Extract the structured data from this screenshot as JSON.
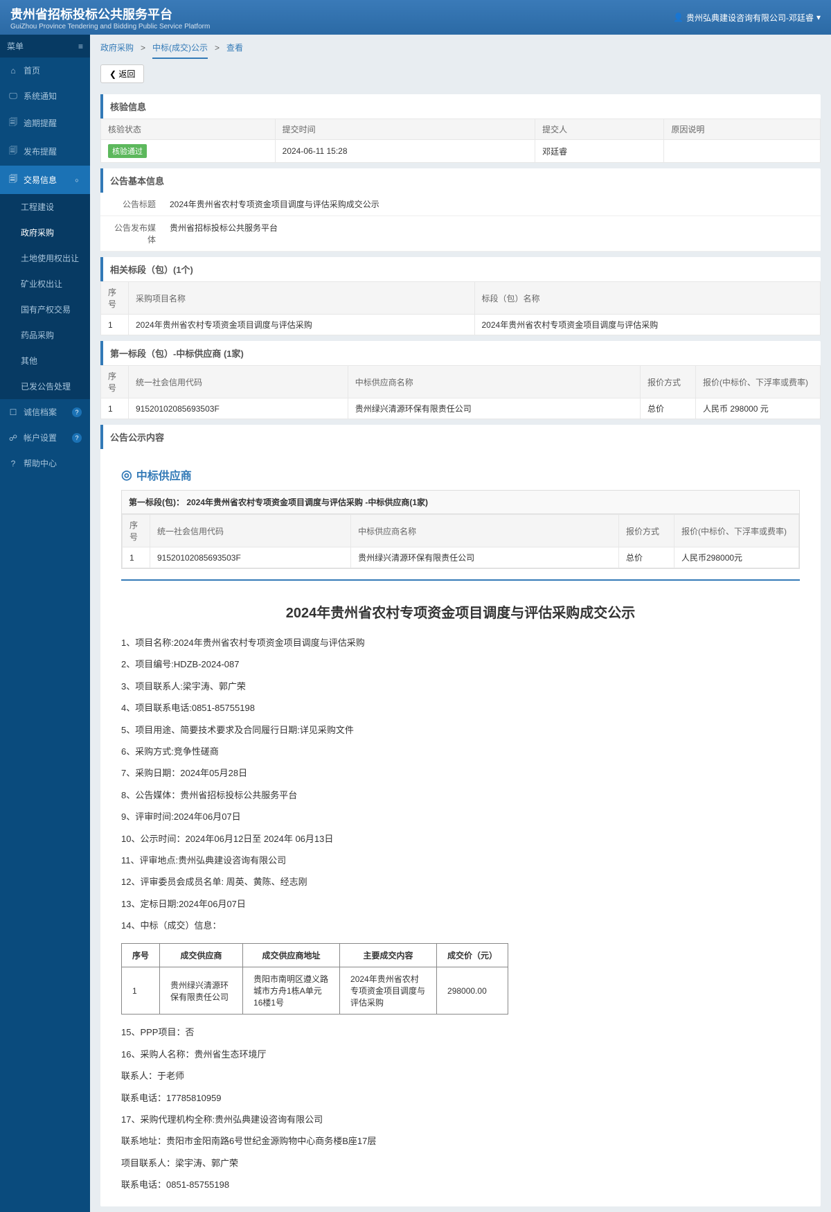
{
  "header": {
    "title": "贵州省招标投标公共服务平台",
    "subtitle": "GuiZhou Province Tendering and Bidding Public Service Platform",
    "user": "贵州弘典建设咨询有限公司-邓廷睿"
  },
  "sidebar": {
    "menu_label": "菜单",
    "items": [
      {
        "icon": "⌂",
        "label": "首页"
      },
      {
        "icon": "🖵",
        "label": "系统通知"
      },
      {
        "icon": "🗐",
        "label": "逾期提醒"
      },
      {
        "icon": "🗐",
        "label": "发布提醒"
      },
      {
        "icon": "🗐",
        "label": "交易信息",
        "badge": "○",
        "active": true
      },
      {
        "icon": "☐",
        "label": "诚信档案",
        "badge": "?"
      },
      {
        "icon": "☍",
        "label": "帐户设置",
        "badge": "?"
      },
      {
        "icon": "?",
        "label": "帮助中心"
      }
    ],
    "submenu": [
      "工程建设",
      "政府采购",
      "土地使用权出让",
      "矿业权出让",
      "国有产权交易",
      "药品采购",
      "其他",
      "已发公告处理"
    ]
  },
  "breadcrumb": [
    "政府采购",
    "中标(成交)公示",
    "查看"
  ],
  "return_btn": "❮ 返回",
  "verify": {
    "title": "核验信息",
    "headers": [
      "核验状态",
      "提交时间",
      "提交人",
      "原因说明"
    ],
    "row": {
      "status": "核验通过",
      "time": "2024-06-11 15:28",
      "person": "邓廷睿",
      "reason": ""
    }
  },
  "basic": {
    "title": "公告基本信息",
    "rows": [
      {
        "label": "公告标题",
        "value": "2024年贵州省农村专项资金项目调度与评估采购成交公示"
      },
      {
        "label": "公告发布媒体",
        "value": "贵州省招标投标公共服务平台"
      }
    ]
  },
  "sections": {
    "title": "相关标段（包）(1个)",
    "headers": [
      "序号",
      "采购项目名称",
      "标段（包）名称"
    ],
    "rows": [
      [
        "1",
        "2024年贵州省农村专项资金项目调度与评估采购",
        "2024年贵州省农村专项资金项目调度与评估采购"
      ]
    ]
  },
  "supplier": {
    "title": "第一标段（包）-中标供应商 (1家)",
    "headers": [
      "序号",
      "统一社会信用代码",
      "中标供应商名称",
      "报价方式",
      "报价(中标价、下浮率或费率)"
    ],
    "rows": [
      [
        "1",
        "91520102085693503F",
        "贵州绿兴清源环保有限责任公司",
        "总价",
        "人民币 298000 元"
      ]
    ]
  },
  "content": {
    "title": "公告公示内容",
    "supplier_label": "中标供应商",
    "sup_title": "第一标段(包)：  2024年贵州省农村专项资金项目调度与评估采购 -中标供应商(1家)",
    "sup_headers": [
      "序号",
      "统一社会信用代码",
      "中标供应商名称",
      "报价方式",
      "报价(中标价、下浮率或费率)"
    ],
    "sup_rows": [
      [
        "1",
        "91520102085693503F",
        "贵州绿兴清源环保有限责任公司",
        "总价",
        "人民币298000元"
      ]
    ],
    "doc_title": "2024年贵州省农村专项资金项目调度与评估采购成交公示",
    "paragraphs": [
      "1、项目名称:2024年贵州省农村专项资金项目调度与评估采购",
      "2、项目编号:HDZB-2024-087",
      "3、项目联系人:梁宇涛、郭广荣",
      "4、项目联系电话:0851-85755198",
      "5、项目用途、简要技术要求及合同履行日期:详见采购文件",
      "6、采购方式:竞争性磋商",
      "7、采购日期：2024年05月28日",
      "8、公告媒体：贵州省招标投标公共服务平台",
      "9、评审时间:2024年06月07日",
      "10、公示时间：2024年06月12日至  2024年  06月13日",
      "11、评审地点:贵州弘典建设咨询有限公司",
      "12、评审委员会成员名单: 周英、黄陈、经志刚",
      "13、定标日期:2024年06月07日",
      "14、中标（成交）信息："
    ],
    "deal_headers": [
      "序号",
      "成交供应商",
      "成交供应商地址",
      "主要成交内容",
      "成交价（元）"
    ],
    "deal_rows": [
      [
        "1",
        "贵州绿兴清源环保有限责任公司",
        "贵阳市南明区遵义路城市方舟1栋A单元16楼1号",
        "2024年贵州省农村专项资金项目调度与评估采购",
        "298000.00"
      ]
    ],
    "paragraphs2": [
      "15、PPP项目：否",
      "16、采购人名称：贵州省生态环境厅",
      "联系人：于老师",
      "联系电话：17785810959",
      "17、采购代理机构全称:贵州弘典建设咨询有限公司",
      "联系地址：贵阳市金阳南路6号世纪金源购物中心商务楼B座17层",
      "项目联系人：梁宇涛、郭广荣",
      "联系电话：0851-85755198"
    ]
  }
}
